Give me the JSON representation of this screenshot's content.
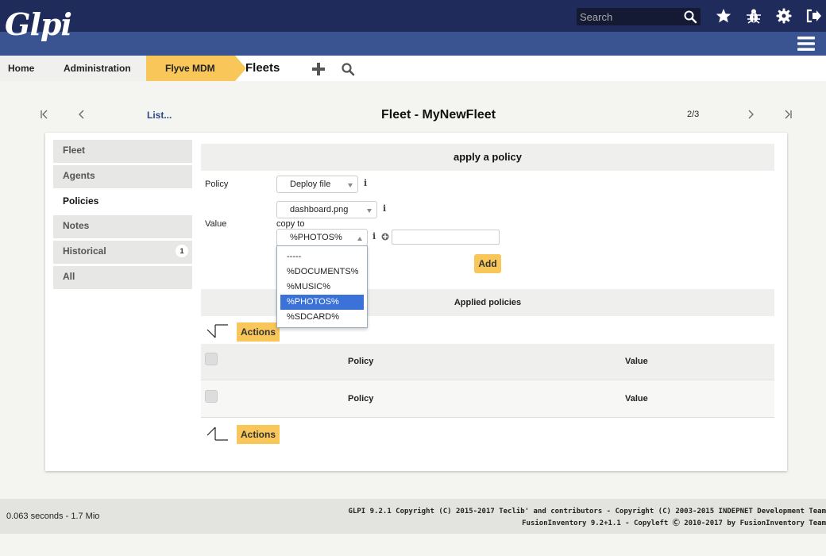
{
  "header": {
    "logo_text": "Glpi",
    "search_placeholder": "Search",
    "icons": [
      "search-icon",
      "star-icon",
      "bug-icon",
      "gear-icon",
      "logout-icon",
      "menu-icon"
    ],
    "colors": {
      "top": "#1f2b5b",
      "sub": "#3a5391",
      "accent": "#f9c65a"
    }
  },
  "breadcrumb": {
    "items": [
      "Home",
      "Administration",
      "Flyve MDM"
    ],
    "current": "Fleets"
  },
  "nav": {
    "list_label": "List...",
    "title": "Fleet - MyNewFleet",
    "counter": "2/3"
  },
  "tabs": [
    {
      "label": "Fleet"
    },
    {
      "label": "Agents"
    },
    {
      "label": "Policies"
    },
    {
      "label": "Notes"
    },
    {
      "label": "Historical",
      "badge": "1"
    },
    {
      "label": "All"
    }
  ],
  "form": {
    "heading": "apply a policy",
    "policy_label": "Policy",
    "policy_value": "Deploy file",
    "value_label": "Value",
    "file_value": "dashboard.png",
    "copy_to_label": "copy to",
    "copy_to_value": "%PHOTOS%",
    "add_label": "Add",
    "dropdown_options": [
      "-----",
      "%DOCUMENTS%",
      "%MUSIC%",
      "%PHOTOS%",
      "%SDCARD%"
    ],
    "dropdown_selected": "%PHOTOS%"
  },
  "applied": {
    "heading": "Applied policies",
    "actions_label": "Actions",
    "columns": [
      "Policy",
      "Value"
    ]
  },
  "footer": {
    "timing": "0.063 seconds - 1.7 Mio",
    "copyright_line1": "GLPI 9.2.1 Copyright (C) 2015-2017 Teclib' and contributors - Copyright (C) 2003-2015 INDEPNET Development Team",
    "copyright_line2": "FusionInventory 9.2+1.1 - Copyleft Ⓒ 2010-2017 by FusionInventory Team"
  }
}
